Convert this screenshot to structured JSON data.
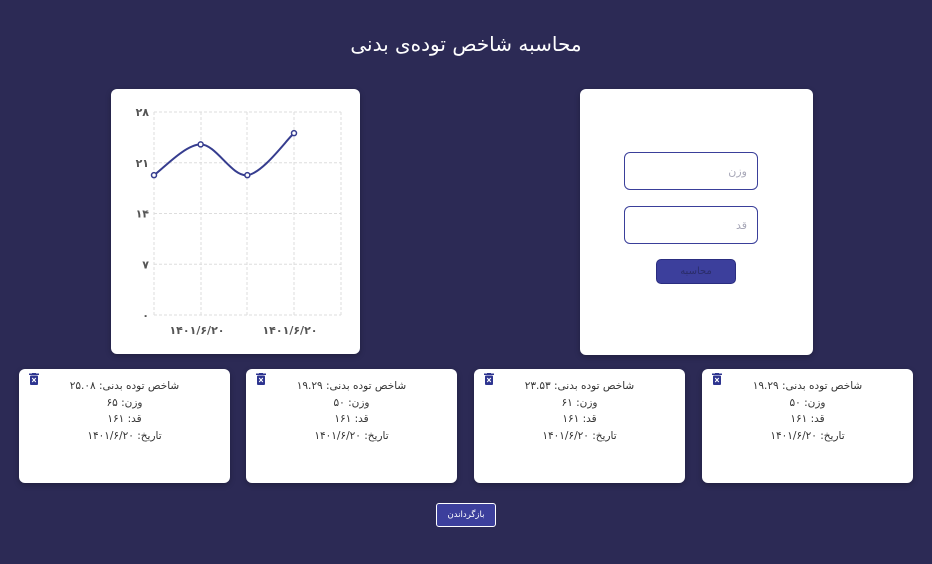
{
  "header": {
    "title": "محاسبه شاخص توده‌ی بدنی"
  },
  "form": {
    "weight_placeholder": "وزن",
    "height_placeholder": "قد",
    "submit_label": "محاسبه"
  },
  "colors": {
    "background": "#2c2a55",
    "accent": "#3c3f9c",
    "line": "#363d8f"
  },
  "chart_data": {
    "type": "line",
    "x": [
      "۱۴۰۱/۶/۲۰",
      "۱۴۰۱/۶/۲۰",
      "۱۴۰۱/۶/۲۰",
      "۱۴۰۱/۶/۲۰"
    ],
    "x_tick_labels": [
      "۱۴۰۱/۶/۲۰",
      "۱۴۰۱/۶/۲۰"
    ],
    "y_tick_labels": [
      "۰",
      "۷",
      "۱۴",
      "۲۱",
      "۲۸"
    ],
    "series": [
      {
        "values": [
          19.29,
          23.53,
          19.29,
          25.08
        ]
      }
    ],
    "ylim": [
      0,
      28
    ],
    "grid": true,
    "smooth": true
  },
  "records": [
    {
      "bmi_label": "شاخص توده بدنی: ۱۹.۲۹",
      "weight_label": "وزن: ۵۰",
      "height_label": "قد: ۱۶۱",
      "date_label": "تاریخ: ۱۴۰۱/۶/۲۰"
    },
    {
      "bmi_label": "شاخص توده بدنی: ۲۳.۵۳",
      "weight_label": "وزن: ۶۱",
      "height_label": "قد: ۱۶۱",
      "date_label": "تاریخ: ۱۴۰۱/۶/۲۰"
    },
    {
      "bmi_label": "شاخص توده بدنی: ۱۹.۲۹",
      "weight_label": "وزن: ۵۰",
      "height_label": "قد: ۱۶۱",
      "date_label": "تاریخ: ۱۴۰۱/۶/۲۰"
    },
    {
      "bmi_label": "شاخص توده بدنی: ۲۵.۰۸",
      "weight_label": "وزن: ۶۵",
      "height_label": "قد: ۱۶۱",
      "date_label": "تاریخ: ۱۴۰۱/۶/۲۰"
    }
  ],
  "footer": {
    "reset_label": "بازگرداندن"
  }
}
